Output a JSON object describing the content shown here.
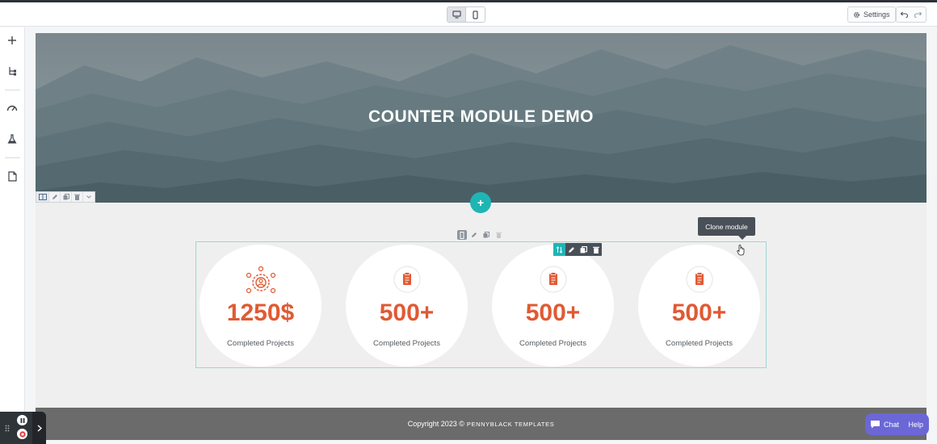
{
  "topbar": {
    "devices": [
      {
        "name": "desktop",
        "icon": "desktop-icon",
        "active": true
      },
      {
        "name": "mobile",
        "icon": "mobile-icon",
        "active": false
      }
    ],
    "settings_label": "Settings",
    "undo_icon": "undo-icon",
    "redo_icon": "redo-icon"
  },
  "leftbar": {
    "items": [
      {
        "icon": "plus-icon"
      },
      {
        "icon": "tree-structure-icon"
      },
      {
        "icon": "gauge-icon"
      },
      {
        "icon": "flask-icon"
      },
      {
        "icon": "page-icon"
      }
    ]
  },
  "hero": {
    "title": "COUNTER MODULE DEMO"
  },
  "add_section_label": "+",
  "tooltip_text": "Clone module",
  "counters": [
    {
      "value": "1250$",
      "label": "Completed Projects",
      "icon": "gear-people-icon"
    },
    {
      "value": "500+",
      "label": "Completed Projects",
      "icon": "clipboard-icon"
    },
    {
      "value": "500+",
      "label": "Completed Projects",
      "icon": "clipboard-icon"
    },
    {
      "value": "500+",
      "label": "Completed Projects",
      "icon": "clipboard-icon"
    }
  ],
  "footer": {
    "copyright": "Copyright 2023 ©",
    "brand": "PENNYBLACK TEMPLATES"
  },
  "chat": {
    "chat_label": "Chat",
    "help_label": "Help"
  },
  "colors": {
    "accent_teal": "#1fb5b5",
    "counter_orange": "#e05a33",
    "chat_purple": "#6b67d6",
    "footer_gray": "#6b6b6b"
  }
}
